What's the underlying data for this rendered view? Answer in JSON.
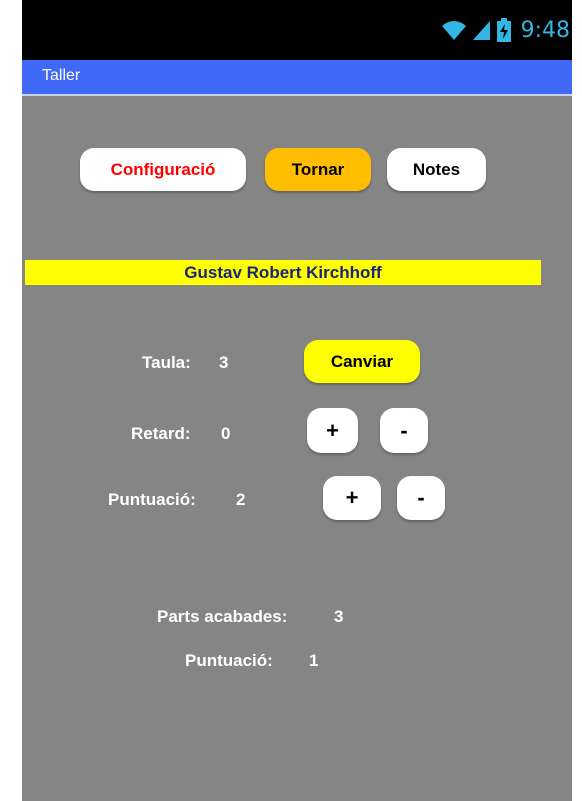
{
  "status": {
    "time": "9:48",
    "icons": [
      "wifi-icon",
      "signal-icon",
      "battery-charging-icon"
    ]
  },
  "app": {
    "title": "Taller"
  },
  "top_buttons": {
    "configuracio": "Configuració",
    "tornar": "Tornar",
    "notes": "Notes"
  },
  "player": {
    "name": "Gustav Robert Kirchhoff"
  },
  "table": {
    "label": "Taula:",
    "value": "3",
    "change_button": "Canviar"
  },
  "delay": {
    "label": "Retard:",
    "value": "0",
    "plus": "+",
    "minus": "-"
  },
  "score": {
    "label": "Puntuació:",
    "value": "2",
    "plus": "+",
    "minus": "-"
  },
  "summary": {
    "parts_label": "Parts acabades:",
    "parts_value": "3",
    "score_label": "Puntuació:",
    "score_value": "1"
  },
  "colors": {
    "background": "#858585",
    "title_bar": "#4169f7",
    "tornar": "#ffbf00",
    "canviar": "#ffff00",
    "name_band": "#ffff00",
    "configuracio_text": "#ff0000",
    "name_text": "#1a237e"
  }
}
